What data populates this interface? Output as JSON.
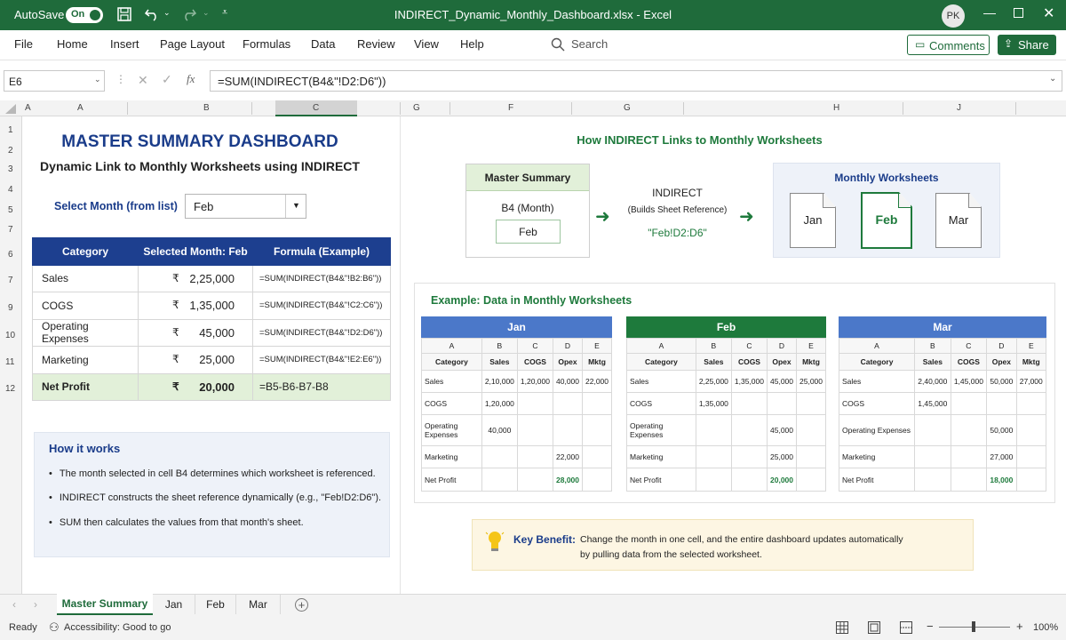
{
  "titlebar": {
    "autosave": "AutoSave",
    "autosave_state": "On",
    "filename": "INDIRECT_Dynamic_Monthly_Dashboard.xlsx",
    "sep": "-",
    "app": "Excel",
    "avatar": "PK"
  },
  "menu": {
    "items": [
      "File",
      "Home",
      "Insert",
      "Page Layout",
      "Formulas",
      "Data",
      "Review",
      "View",
      "Help"
    ],
    "search": "Search",
    "comments": "Comments",
    "share": "Share"
  },
  "formula_bar": {
    "cell_ref": "E6",
    "fx": "fx",
    "formula": "=SUM(INDIRECT(B4&\"!D2:D6\"))"
  },
  "columns": [
    "A",
    "A",
    "B",
    "C",
    "G",
    "F",
    "G",
    "H",
    "J"
  ],
  "rows": [
    "1",
    "2",
    "3",
    "4",
    "5",
    "7",
    "6",
    "7",
    "9",
    "10",
    "11",
    "12"
  ],
  "dashboard": {
    "title": "MASTER SUMMARY DASHBOARD",
    "subtitle": "Dynamic Link to Monthly Worksheets using INDIRECT",
    "select_label": "Select Month (from list)",
    "selected_month": "Feb",
    "table": {
      "headers": [
        "Category",
        "Selected Month: Feb",
        "Formula (Example)"
      ],
      "currency": "₹",
      "rows": [
        {
          "cat": "Sales",
          "val": "2,25,000",
          "formula": "=SUM(INDIRECT(B4&\"!B2:B6\"))"
        },
        {
          "cat": "COGS",
          "val": "1,35,000",
          "formula": "=SUM(INDIRECT(B4&\"!C2:C6\"))"
        },
        {
          "cat": "Operating Expenses",
          "val": "45,000",
          "formula": "=SUM(INDIRECT(B4&\"!D2:D6\"))"
        },
        {
          "cat": "Marketing",
          "val": "25,000",
          "formula": "=SUM(INDIRECT(B4&\"!E2:E6\"))"
        }
      ],
      "net": {
        "cat": "Net Profit",
        "val": "20,000",
        "formula": "=B5-B6-B7-B8"
      }
    },
    "how": {
      "title": "How it works",
      "items": [
        "The month selected in cell B4 determines which worksheet is referenced.",
        "INDIRECT constructs the sheet reference dynamically (e.g., \"Feb!D2:D6\").",
        "SUM then calculates the values from that month's sheet."
      ]
    }
  },
  "diagram": {
    "title": "How INDIRECT Links to Monthly Worksheets",
    "master_title": "Master Summary",
    "master_cell": "B4 (Month)",
    "master_value": "Feb",
    "indirect": "INDIRECT",
    "indirect_sub": "(Builds Sheet Reference)",
    "ref": "\"Feb!D2:D6\"",
    "monthly_title": "Monthly Worksheets",
    "sheets": [
      "Jan",
      "Feb",
      "Mar"
    ]
  },
  "example": {
    "title": "Example: Data in Monthly Worksheets",
    "col_letters": [
      "A",
      "B",
      "C",
      "D",
      "E"
    ],
    "col_headers": [
      "Category",
      "Sales",
      "COGS",
      "Opex",
      "Mktg"
    ],
    "months": [
      {
        "name": "Jan",
        "color": "#4b78c9",
        "rows": [
          [
            "Sales",
            "2,10,000",
            "1,20,000",
            "40,000",
            "22,000"
          ],
          [
            "COGS",
            "1,20,000",
            "",
            "",
            ""
          ],
          [
            "Operating Expenses",
            "40,000",
            "",
            "",
            ""
          ],
          [
            "Marketing",
            "",
            "",
            "22,000",
            ""
          ],
          [
            "Net Profit",
            "",
            "",
            "28,000",
            ""
          ]
        ]
      },
      {
        "name": "Feb",
        "color": "#1e7a3c",
        "rows": [
          [
            "Sales",
            "2,25,000",
            "1,35,000",
            "45,000",
            "25,000"
          ],
          [
            "COGS",
            "1,35,000",
            "",
            "",
            ""
          ],
          [
            "Operating Expenses",
            "",
            "",
            "45,000",
            ""
          ],
          [
            "Marketing",
            "",
            "",
            "25,000",
            ""
          ],
          [
            "Net Profit",
            "",
            "",
            "20,000",
            ""
          ]
        ]
      },
      {
        "name": "Mar",
        "color": "#4b78c9",
        "rows": [
          [
            "Sales",
            "2,40,000",
            "1,45,000",
            "50,000",
            "27,000"
          ],
          [
            "COGS",
            "1,45,000",
            "",
            "",
            ""
          ],
          [
            "Operating Expenses",
            "",
            "",
            "50,000",
            ""
          ],
          [
            "Marketing",
            "",
            "",
            "27,000",
            ""
          ],
          [
            "Net Profit",
            "",
            "",
            "18,000",
            ""
          ]
        ]
      }
    ]
  },
  "benefit": {
    "label": "Key Benefit:",
    "text1": "Change the month in one cell, and the entire dashboard updates automatically",
    "text2": "by pulling data from the selected worksheet."
  },
  "tabs": [
    "Master Summary",
    "Jan",
    "Feb",
    "Mar"
  ],
  "status": {
    "ready": "Ready",
    "accessibility": "Accessibility: Good to go",
    "zoom": "100%"
  },
  "colors": {
    "excel_green": "#1f6b3b",
    "navy": "#1a3c8a",
    "header_blue": "#1d3f8f",
    "net_profit_bg": "#e2f0d9"
  }
}
